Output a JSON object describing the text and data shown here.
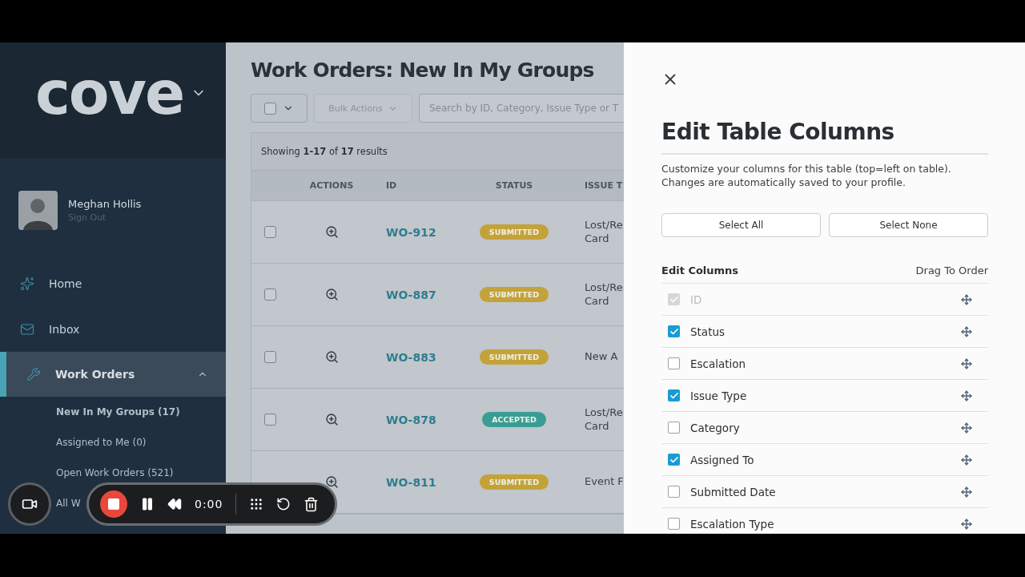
{
  "sidebar": {
    "logo": "cove",
    "user": {
      "name": "Meghan Hollis",
      "action": "Sign Out"
    },
    "nav": [
      {
        "label": "Home",
        "selected": false
      },
      {
        "label": "Inbox",
        "selected": false
      },
      {
        "label": "Work Orders",
        "selected": true,
        "expanded": true,
        "children": [
          {
            "label": "New In My Groups (17)",
            "selected": true
          },
          {
            "label": "Assigned to Me (0)",
            "selected": false
          },
          {
            "label": "Open Work Orders (521)",
            "selected": false
          },
          {
            "label": "All W",
            "selected": false
          }
        ]
      }
    ]
  },
  "main": {
    "title": "Work Orders: New In My Groups",
    "bulk_actions": "Bulk Actions",
    "search": {
      "placeholder": "Search by ID, Category, Issue Type or T"
    },
    "summary": "Showing **1-17** of **17** results",
    "columns": [
      "ACTIONS",
      "ID",
      "STATUS",
      "ISSUE T"
    ],
    "rows": [
      {
        "checked": false,
        "id": "WO-912",
        "status": {
          "label": "SUBMITTED",
          "kind": "submitted"
        },
        "issue": [
          "Lost/Re",
          "Card"
        ]
      },
      {
        "checked": false,
        "id": "WO-887",
        "status": {
          "label": "SUBMITTED",
          "kind": "submitted"
        },
        "issue": [
          "Lost/Re",
          "Card"
        ]
      },
      {
        "checked": false,
        "id": "WO-883",
        "status": {
          "label": "SUBMITTED",
          "kind": "submitted"
        },
        "issue": [
          "New A"
        ]
      },
      {
        "checked": false,
        "id": "WO-878",
        "status": {
          "label": "ACCEPTED",
          "kind": "accepted"
        },
        "issue": [
          "Lost/Re",
          "Card"
        ]
      },
      {
        "id": "WO-811",
        "status": {
          "label": "SUBMITTED",
          "kind": "submitted"
        },
        "issue": [
          "Event F"
        ]
      }
    ]
  },
  "panel": {
    "title": "Edit Table Columns",
    "description": [
      "Customize your columns for this table (top=left on table).",
      "Changes are automatically saved to your profile."
    ],
    "buttons": [
      "Select All",
      "Select None"
    ],
    "section": "Edit Columns",
    "hint": "Drag To Order",
    "columns": [
      {
        "label": "ID",
        "checked": true,
        "disabled": true
      },
      {
        "label": "Status",
        "checked": true
      },
      {
        "label": "Escalation",
        "checked": false
      },
      {
        "label": "Issue Type",
        "checked": true
      },
      {
        "label": "Category",
        "checked": false
      },
      {
        "label": "Assigned To",
        "checked": true
      },
      {
        "label": "Submitted Date",
        "checked": false
      },
      {
        "label": "Escalation Type",
        "checked": false
      }
    ]
  },
  "recorder": {
    "time": "0:00"
  }
}
